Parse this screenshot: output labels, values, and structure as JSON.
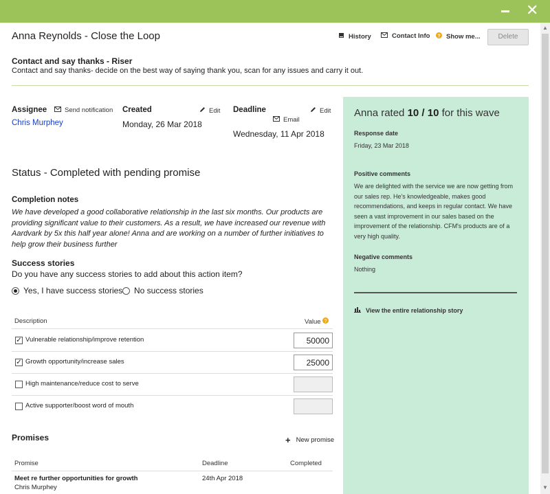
{
  "window": {
    "minimize_icon": "minus-icon",
    "close_icon": "close-x-icon",
    "accent_color": "#9bc35a",
    "panel_color": "#c9ecd9",
    "link_color": "#1a3fc4"
  },
  "header": {
    "title": "Anna Reynolds - Close the Loop",
    "history_label": "History",
    "contact_info_label": "Contact Info",
    "show_me_label": "Show me...",
    "delete_label": "Delete"
  },
  "action": {
    "title": "Contact and say thanks - Riser",
    "description": "Contact and say thanks- decide on the best way of saying thank you, scan for any issues and carry it out."
  },
  "assignee": {
    "label": "Assignee",
    "send_notification": "Send notification",
    "name": "Chris Murphey"
  },
  "created": {
    "label": "Created",
    "edit": "Edit",
    "date": "Monday, 26 Mar 2018"
  },
  "deadline": {
    "label": "Deadline",
    "edit": "Edit",
    "email": "Email",
    "date": "Wednesday, 11 Apr 2018"
  },
  "status": "Status - Completed with pending promise",
  "completion_notes": {
    "title": "Completion notes",
    "text": "We have developed a good collaborative relationship in the last six months. Our products are providing significant value to their customers. As a result, we have increased our revenue with Aardvark by 5x this half year alone! Anna and are working on a number of further initiatives to help grow their business further"
  },
  "success_stories": {
    "title": "Success stories",
    "question": "Do you have any success stories to add about this action item?",
    "option_yes": "Yes, I have success stories",
    "option_no": "No success stories",
    "selected": "yes",
    "col_description": "Description",
    "col_value": "Value",
    "rows": [
      {
        "label": "Vulnerable relationship/improve retention",
        "checked": true,
        "value": "50000"
      },
      {
        "label": "Growth opportunity/increase sales",
        "checked": true,
        "value": "25000"
      },
      {
        "label": "High maintenance/reduce cost to serve",
        "checked": false,
        "value": ""
      },
      {
        "label": "Active supporter/boost word of mouth",
        "checked": false,
        "value": ""
      }
    ]
  },
  "promises": {
    "title": "Promises",
    "new_label": "New promise",
    "col_promise": "Promise",
    "col_deadline": "Deadline",
    "col_completed": "Completed",
    "items": [
      {
        "promise": "Meet re further opportunities for growth",
        "owner": "Chris Murphey",
        "deadline": "24th Apr 2018",
        "completed": ""
      }
    ]
  },
  "panel": {
    "rated_prefix": "Anna rated",
    "rating": "10 / 10",
    "rated_suffix": "for this wave",
    "response_date_label": "Response date",
    "response_date": "Friday, 23 Mar 2018",
    "positive_label": "Positive comments",
    "positive_text": "We are delighted with the service we are now getting from our sales rep. He's knowledgeable, makes good recommendations, and keeps in regular contact. We have seen a vast improvement in our sales based on the improvement of the relationship. CFM's products are of a very high quality.",
    "negative_label": "Negative comments",
    "negative_text": "Nothing",
    "story_link": "View the entire relationship story"
  }
}
